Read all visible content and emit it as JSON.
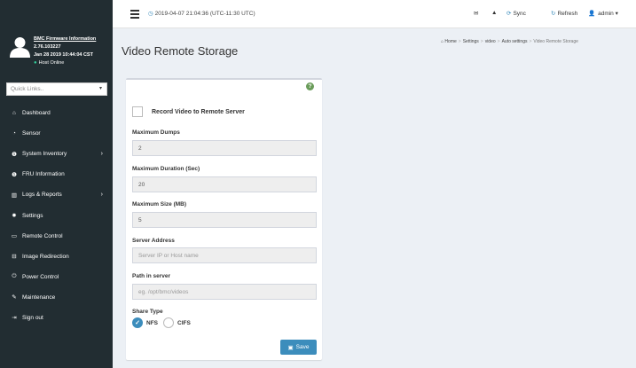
{
  "user": {
    "link": "BMC Firmware Information",
    "version": "2.76.103227",
    "date": "Jan 28 2019 10:44:04 CST",
    "status": "Host Online"
  },
  "quick_links": {
    "placeholder": "Quick Links.."
  },
  "menu": [
    {
      "label": "Dashboard",
      "icon": "dashboard-icon"
    },
    {
      "label": "Sensor",
      "icon": "sensor-icon"
    },
    {
      "label": "System Inventory",
      "icon": "info-icon",
      "expandable": true
    },
    {
      "label": "FRU Information",
      "icon": "info-icon"
    },
    {
      "label": "Logs & Reports",
      "icon": "chart-icon",
      "expandable": true
    },
    {
      "label": "Settings",
      "icon": "gear-icon"
    },
    {
      "label": "Remote Control",
      "icon": "monitor-icon"
    },
    {
      "label": "Image Redirection",
      "icon": "disk-icon"
    },
    {
      "label": "Power Control",
      "icon": "power-icon"
    },
    {
      "label": "Maintenance",
      "icon": "wrench-icon"
    },
    {
      "label": "Sign out",
      "icon": "signout-icon"
    }
  ],
  "topbar": {
    "time": "2019-04-07 21:04:36 (UTC-11:30 UTC)",
    "sync": "Sync",
    "refresh": "Refresh",
    "user": "admin"
  },
  "page": {
    "title": "Video Remote Storage",
    "breadcrumb": [
      "Home",
      "Settings",
      "video",
      "Auto settings",
      "Video Remote Storage"
    ]
  },
  "form": {
    "record_label": "Record Video to Remote Server",
    "record_checked": false,
    "max_dumps_label": "Maximum Dumps",
    "max_dumps": "2",
    "max_duration_label": "Maximum Duration (Sec)",
    "max_duration": "20",
    "max_size_label": "Maximum Size (MB)",
    "max_size": "5",
    "server_label": "Server Address",
    "server_placeholder": "Server IP or Host name",
    "path_label": "Path in server",
    "path_placeholder": "eg. /opt/bmc/videos",
    "share_label": "Share Type",
    "share_nfs": "NFS",
    "share_cifs": "CIFS",
    "share_selected": "NFS",
    "save_label": "Save"
  },
  "colors": {
    "sidebar_bg": "#222d32",
    "accent": "#3c8dbc",
    "content_bg": "#ecf0f5"
  }
}
